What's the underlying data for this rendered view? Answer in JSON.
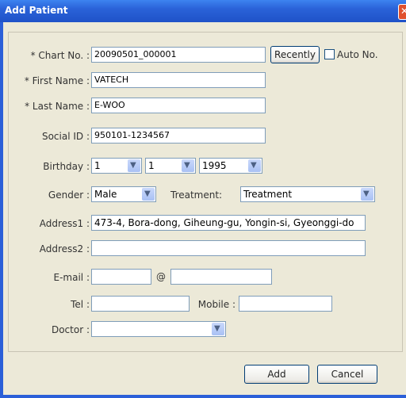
{
  "window": {
    "title": "Add Patient",
    "close_glyph": "✕"
  },
  "form": {
    "chart_no": {
      "label": "* Chart No. :",
      "value": "20090501_000001"
    },
    "recently_button": "Recently",
    "auto_no_label": "Auto No.",
    "auto_no_checked": false,
    "first_name": {
      "label": "* First Name :",
      "value": "VATECH"
    },
    "last_name": {
      "label": "* Last Name :",
      "value": "E-WOO"
    },
    "social_id": {
      "label": "Social ID :",
      "value": "950101-1234567"
    },
    "birthday": {
      "label": "Birthday :",
      "month": "1",
      "day": "1",
      "year": "1995"
    },
    "gender": {
      "label": "Gender :",
      "value": "Male"
    },
    "treatment": {
      "label": "Treatment:",
      "value": "Treatment"
    },
    "address1": {
      "label": "Address1 :",
      "value": "473-4, Bora-dong, Giheung-gu, Yongin-si, Gyeonggi-do"
    },
    "address2": {
      "label": "Address2 :",
      "value": ""
    },
    "email": {
      "label": "E-mail :",
      "at": "@",
      "user": "",
      "domain": ""
    },
    "tel": {
      "label": "Tel :",
      "value": ""
    },
    "mobile": {
      "label": "Mobile :",
      "value": ""
    },
    "doctor": {
      "label": "Doctor :",
      "value": ""
    }
  },
  "buttons": {
    "add": "Add",
    "cancel": "Cancel"
  },
  "icons": {
    "dropdown": "chevron-down-icon",
    "close": "close-icon"
  },
  "colors": {
    "titlebar": "#2a62d8",
    "dialog_bg": "#ece9d8",
    "field_border": "#7f9db9"
  }
}
